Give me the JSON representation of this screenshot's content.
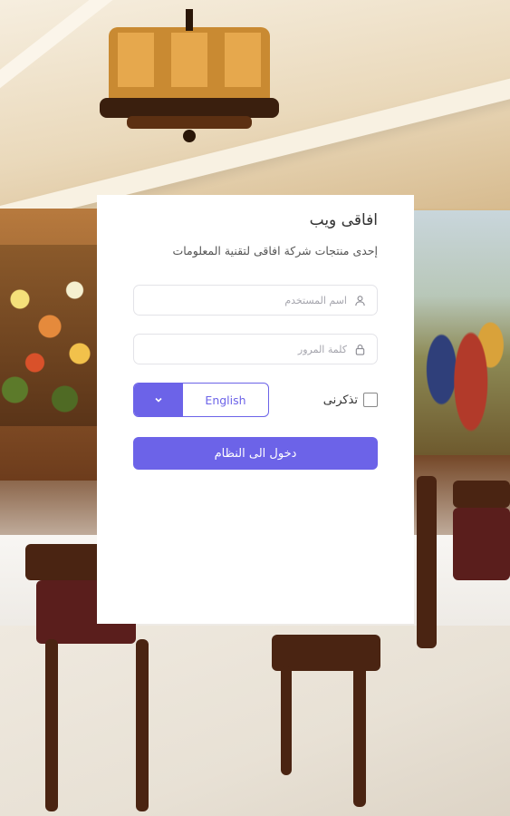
{
  "app": {
    "title": "افاقى ويب",
    "subtitle": "إحدى منتجات شركة افاقى لتقنية المعلومات"
  },
  "form": {
    "username_placeholder": "اسم المستخدم",
    "password_placeholder": "كلمة المرور",
    "username_icon": "user-icon",
    "password_icon": "lock-icon",
    "remember_label": "تذكرنى",
    "remember_checked": false,
    "language_value": "English",
    "language_icon": "chevron-down-icon",
    "login_label": "دخول الى النظام"
  },
  "colors": {
    "accent": "#6c63e8",
    "card": "#ffffff",
    "placeholder": "#a5a5ad"
  }
}
